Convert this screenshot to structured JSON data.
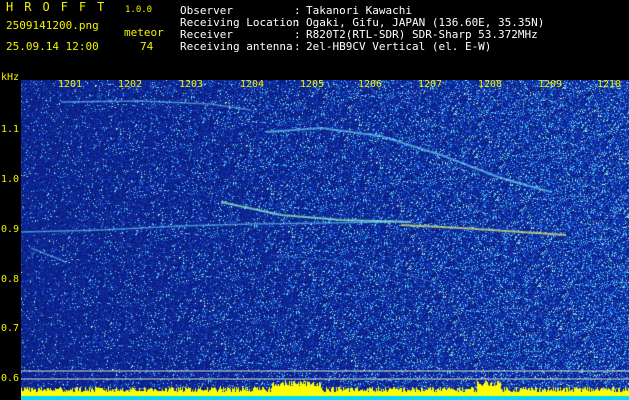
{
  "app": {
    "title": "HROFFT",
    "version": "1.0.0",
    "filename": "2509141200.png",
    "datetime": "25.09.14 12:00",
    "type_label": "meteor",
    "count": "74"
  },
  "info": [
    {
      "key": "Observer",
      "value": "Takanori Kawachi"
    },
    {
      "key": "Receiving Location",
      "value": "Ogaki, Gifu, JAPAN (136.60E, 35.35N)"
    },
    {
      "key": "Receiver",
      "value": "R820T2(RTL-SDR) SDR-Sharp 53.372MHz"
    },
    {
      "key": "Receiving antenna",
      "value": "2el-HB9CV Vertical (el. E-W)"
    }
  ],
  "axis": {
    "unit": "kHz",
    "time_labels": [
      "1201",
      "1202",
      "1203",
      "1204",
      "1205",
      "1206",
      "1207",
      "1208",
      "1209",
      "1210"
    ],
    "freq_labels": [
      "1.1",
      "1.0",
      "0.9",
      "0.8",
      "0.7",
      "0.6"
    ]
  },
  "colors": {
    "text": "#f2f200",
    "background_noise": "#0a1a8c",
    "signal": "#7fe0ff",
    "strong_signal": "#ffff60",
    "marker_line": "#c8c8c8",
    "bottom_bar": "#ffff00",
    "bottom_bar_low": "#00d8ff"
  }
}
